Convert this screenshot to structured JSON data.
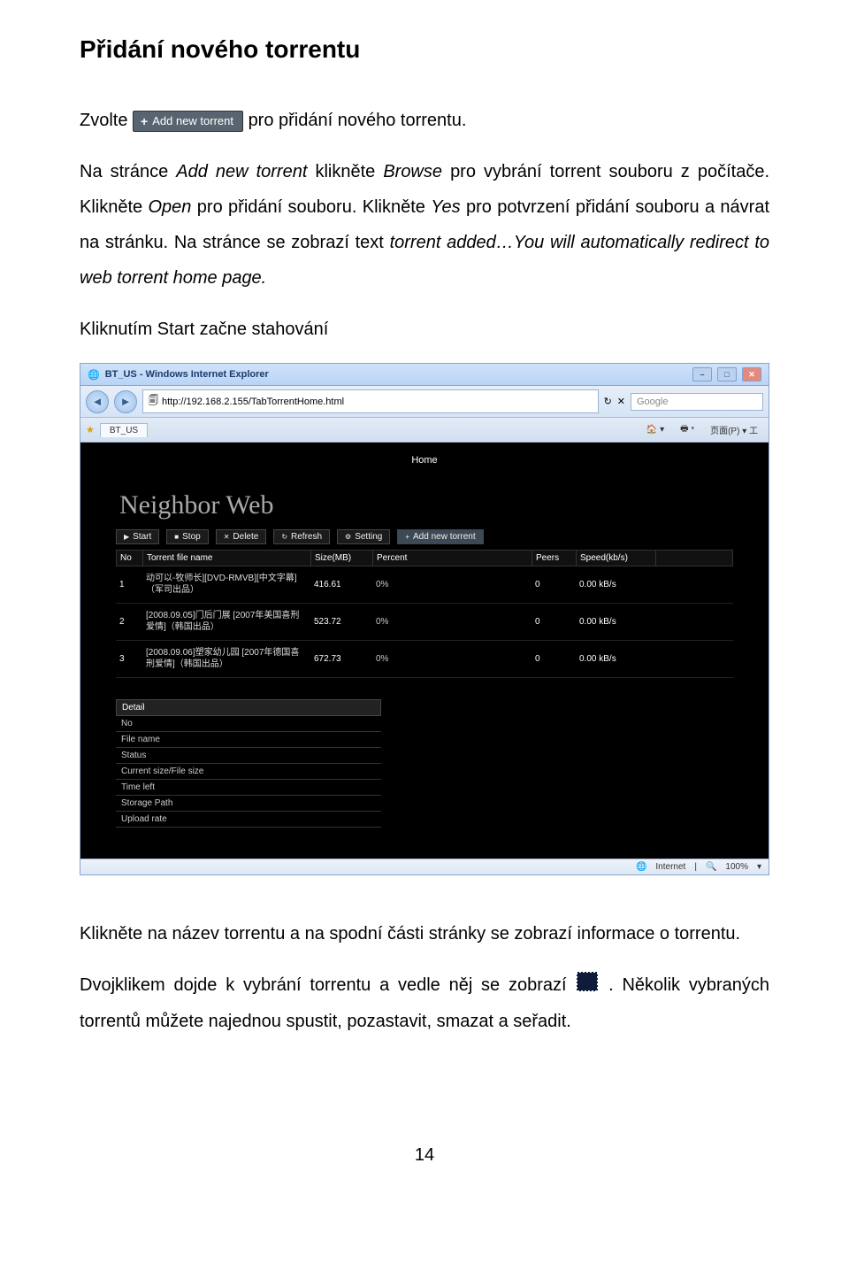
{
  "doc": {
    "heading": "Přidání nového torrentu",
    "p1a": "Zvolte ",
    "p1b": " pro přidání nového torrentu.",
    "p2a": "Na stránce ",
    "p2b": "Add new torrent",
    "p2c": " klikněte ",
    "p2d": "Browse",
    "p2e": " pro vybrání torrent souboru z počítače. Klikněte ",
    "p2f": "Open",
    "p2g": " pro přidání souboru. Klikněte ",
    "p2h": "Yes",
    "p2i": " pro potvrzení přidání souboru a návrat na stránku. Na stránce se zobrazí text ",
    "p2j": "torrent added…You will automatically redirect to web torrent home page.",
    "p3": "Kliknutím Start začne stahování",
    "p4": "Klikněte na název torrentu a na spodní části stránky se zobrazí informace o torrentu.",
    "p5a": "Dvojklikem dojde k vybrání torrentu a vedle něj se zobrazí ",
    "p5b": ". Několik vybraných torrentů můžete najednou spustit, pozastavit, smazat a seřadit.",
    "page_number": "14",
    "add_btn_label": "Add new torrent"
  },
  "shot": {
    "window_title": "BT_US - Windows Internet Explorer",
    "url": "http://192.168.2.155/TabTorrentHome.html",
    "search_placeholder": "Google",
    "tab_label": "BT_US",
    "toolbar_extra": "页面(P) ▾  工",
    "zoom": "100%",
    "status_item": "Internet",
    "page": {
      "home_link": "Home",
      "title": "Neighbor Web",
      "buttons": {
        "start": "Start",
        "stop": "Stop",
        "delete": "Delete",
        "refresh": "Refresh",
        "setting": "Setting",
        "addnew": "Add new torrent"
      },
      "columns": {
        "no": "No",
        "name": "Torrent file name",
        "size": "Size(MB)",
        "percent": "Percent",
        "peers": "Peers",
        "speed": "Speed(kb/s)"
      },
      "rows": [
        {
          "no": "1",
          "name": "动可以-牧师长][DVD-RMVB][中文字幕]（军司出品）",
          "size": "416.61",
          "percent": "0%",
          "peers": "0",
          "speed": "0.00 kB/s"
        },
        {
          "no": "2",
          "name": "[2008.09.05]门后门展 [2007年美国喜刑爱情]（韩国出品）",
          "size": "523.72",
          "percent": "0%",
          "peers": "0",
          "speed": "0.00 kB/s"
        },
        {
          "no": "3",
          "name": "[2008.09.06]塑家幼儿园 [2007年德国喜刑爱情]（韩国出品）",
          "size": "672.73",
          "percent": "0%",
          "peers": "0",
          "speed": "0.00 kB/s"
        }
      ],
      "detail": {
        "header": "Detail",
        "rows": [
          "No",
          "File name",
          "Status",
          "Current size/File size",
          "Time left",
          "Storage Path",
          "Upload rate"
        ]
      }
    }
  }
}
